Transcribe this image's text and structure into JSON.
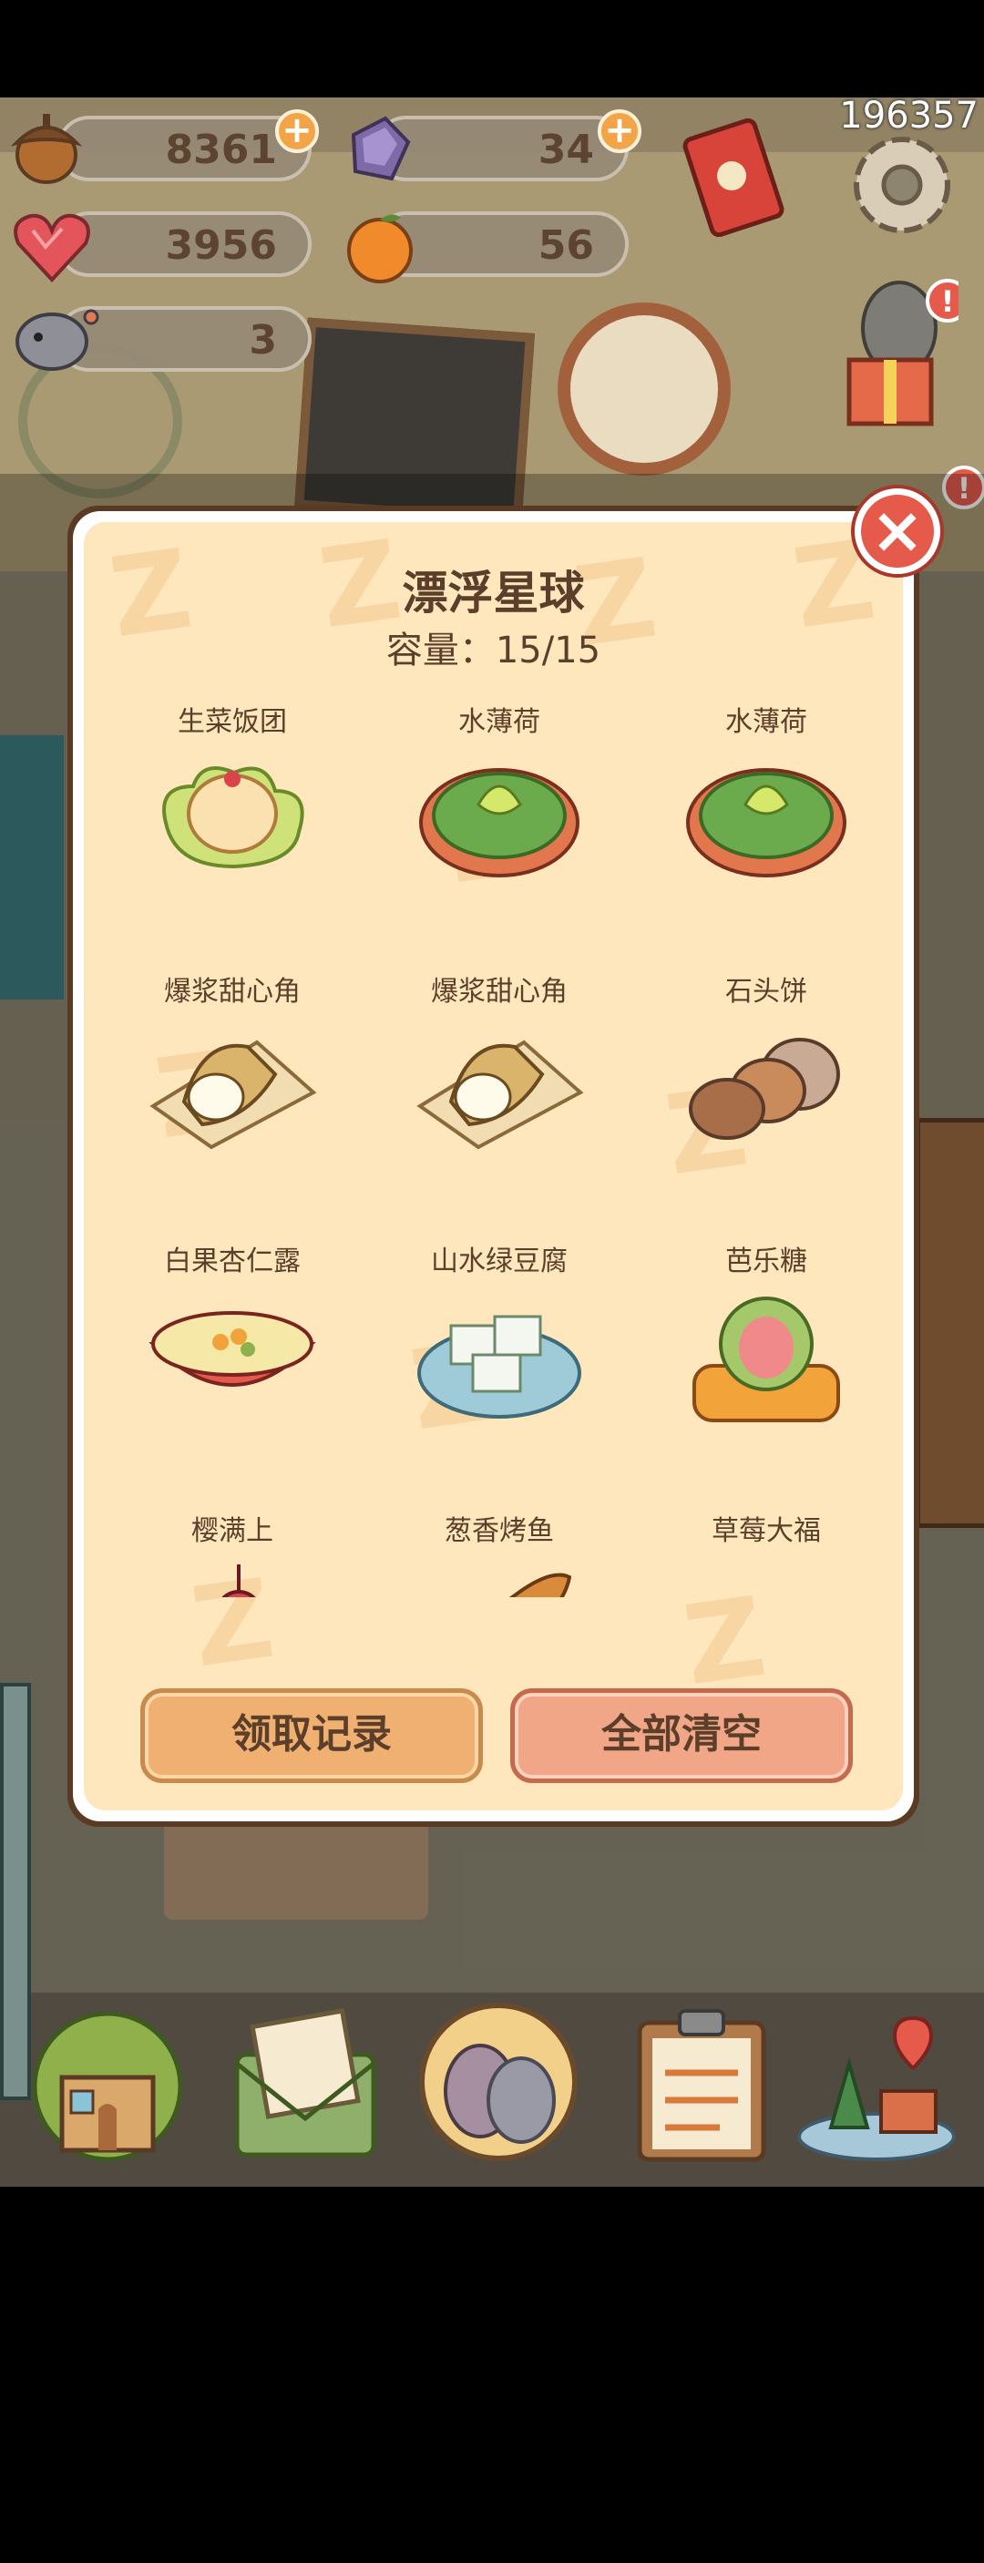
{
  "hud": {
    "resources": [
      {
        "name": "acorn",
        "value": "8361",
        "icon": "acorn-icon"
      },
      {
        "name": "crystal",
        "value": "34",
        "icon": "crystal-icon"
      },
      {
        "name": "heart",
        "value": "3956",
        "icon": "heart-icon"
      },
      {
        "name": "orange",
        "value": "56",
        "icon": "orange-icon"
      },
      {
        "name": "bird",
        "value": "3",
        "icon": "bird-icon"
      }
    ],
    "user_id": "196357"
  },
  "modal": {
    "title": "漂浮星球",
    "capacity": "容量：15/15",
    "watermark": "Z",
    "items": [
      {
        "name": "生菜饭团",
        "icon": "lettuce-riceball-icon"
      },
      {
        "name": "水薄荷",
        "icon": "mint-soup-icon"
      },
      {
        "name": "水薄荷",
        "icon": "mint-soup-icon"
      },
      {
        "name": "爆浆甜心角",
        "icon": "sweet-crepe-icon"
      },
      {
        "name": "爆浆甜心角",
        "icon": "sweet-crepe-icon"
      },
      {
        "name": "石头饼",
        "icon": "stone-cake-icon"
      },
      {
        "name": "白果杏仁露",
        "icon": "ginkgo-almond-soup-icon"
      },
      {
        "name": "山水绿豆腐",
        "icon": "green-tofu-icon"
      },
      {
        "name": "芭乐糖",
        "icon": "guava-candy-icon"
      },
      {
        "name": "樱满上",
        "icon": "cherry-tart-icon"
      },
      {
        "name": "葱香烤鱼",
        "icon": "grilled-fish-icon"
      },
      {
        "name": "草莓大福",
        "icon": "strawberry-daifuku-icon"
      }
    ],
    "buttons": {
      "record": "领取记录",
      "clear": "全部清空"
    },
    "close_icon": "close-icon"
  },
  "bottom_nav": [
    {
      "icon": "house-icon"
    },
    {
      "icon": "letter-icon"
    },
    {
      "icon": "friends-icon"
    },
    {
      "icon": "clipboard-icon"
    },
    {
      "icon": "map-icon"
    }
  ],
  "colors": {
    "accent_orange": "#f2a447",
    "close_red": "#e55a4b",
    "panel_bg": "#ffe7bd",
    "text_brown": "#5c3f2a"
  }
}
